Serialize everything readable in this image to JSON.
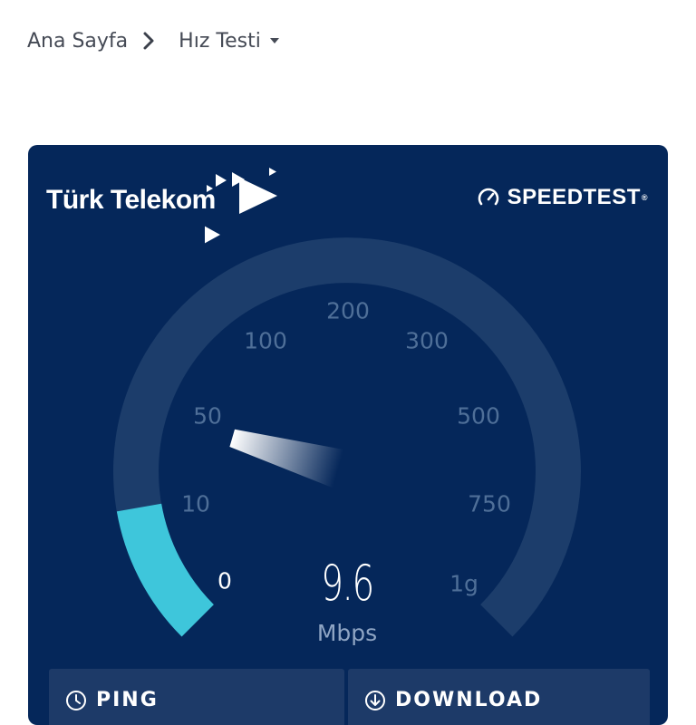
{
  "breadcrumb": {
    "home": "Ana Sayfa",
    "current": "Hız Testi"
  },
  "card": {
    "brand": "Türk Telekom",
    "provider": "SPEEDTEST",
    "trademark": "®"
  },
  "gauge": {
    "ticks": [
      "0",
      "10",
      "50",
      "100",
      "200",
      "300",
      "500",
      "750",
      "1g"
    ],
    "value": "9.6",
    "unit": "Mbps",
    "progress_fraction": 0.13,
    "colors": {
      "track": "#1c3d6b",
      "fill": "#3ec6db",
      "background": "#05275a"
    }
  },
  "panels": {
    "ping_label": "PING",
    "download_label": "DOWNLOAD"
  },
  "icons": {
    "breadcrumb_separator": "chevron-right-icon",
    "dropdown": "caret-down-icon",
    "speedtest_logo": "speedometer-icon",
    "ping": "ping-icon",
    "download": "download-icon"
  }
}
